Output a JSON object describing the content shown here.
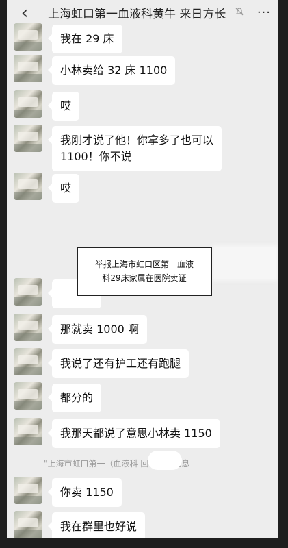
{
  "header": {
    "back_icon": "‹",
    "title": "上海虹口第一血液科黄牛 来日方长",
    "more_icon": "···"
  },
  "messages": [
    {
      "text": "我在 29 床"
    },
    {
      "text": "小林卖给 32 床 1100"
    },
    {
      "text": "哎"
    },
    {
      "text_line1": "我刚才说了他！你拿多了也可以",
      "text_line2": "1100！你不说"
    },
    {
      "text": "哎"
    },
    {
      "text": ""
    },
    {
      "text": "那就卖 1000 啊"
    },
    {
      "text": "我说了还有护工还有跑腿"
    },
    {
      "text": "都分的"
    },
    {
      "text": "我那天都说了意思小林卖 1150"
    },
    {
      "text": "你卖 1150"
    },
    {
      "text": "我在群里也好说"
    }
  ],
  "overlay": {
    "line1": "举报上海市虹口区第一血液",
    "line2": "科29床家属在医院卖证"
  },
  "system_note": "\"上海市虹口第一（血液科            回了一条消息"
}
